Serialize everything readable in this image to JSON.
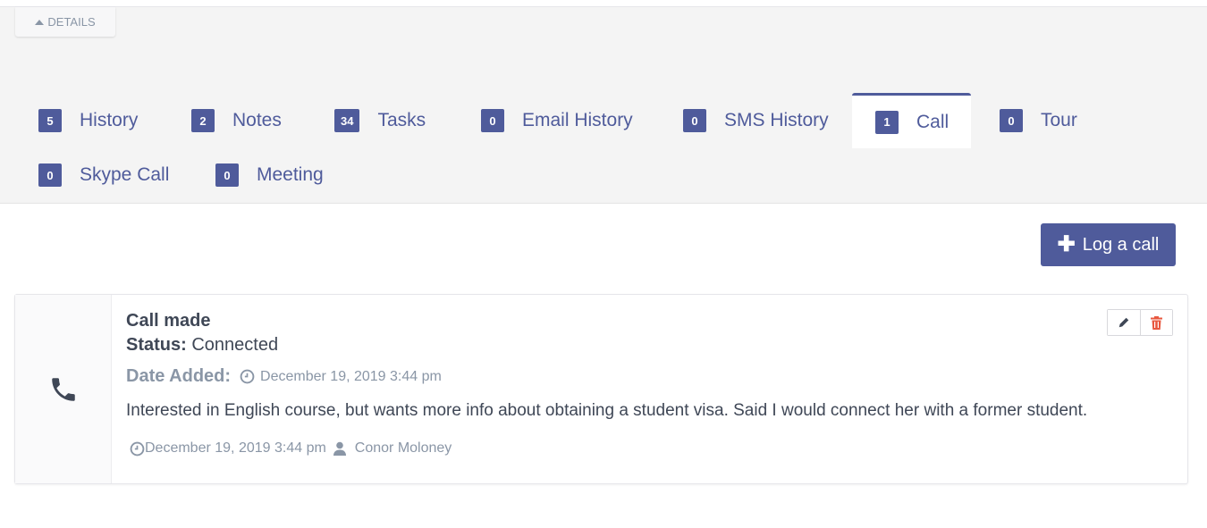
{
  "details_toggle": {
    "label": "DETAILS",
    "icon": "caret-up-icon"
  },
  "tabs": [
    {
      "count": "5",
      "label": "History",
      "active": false
    },
    {
      "count": "2",
      "label": "Notes",
      "active": false
    },
    {
      "count": "34",
      "label": "Tasks",
      "active": false
    },
    {
      "count": "0",
      "label": "Email History",
      "active": false
    },
    {
      "count": "0",
      "label": "SMS History",
      "active": false
    },
    {
      "count": "1",
      "label": "Call",
      "active": true
    },
    {
      "count": "0",
      "label": "Tour",
      "active": false
    },
    {
      "count": "0",
      "label": "Skype Call",
      "active": false
    },
    {
      "count": "0",
      "label": "Meeting",
      "active": false
    }
  ],
  "log_call_button": {
    "label": "Log a call",
    "icon": "plus-icon"
  },
  "call_entry": {
    "icon": "phone-icon",
    "title": "Call made",
    "status_label": "Status:",
    "status_value": "Connected",
    "date_added_label": "Date Added:",
    "date_added_value": "December 19, 2019 3:44 pm",
    "description": "Interested in English course, but wants more info about obtaining a student visa. Said I would connect her with a former student.",
    "meta_date": "December 19, 2019 3:44 pm",
    "meta_user": "Conor Moloney",
    "actions": {
      "edit": "pencil-icon",
      "delete": "trash-icon"
    }
  },
  "colors": {
    "accent": "#4f5b9b",
    "delete": "#e8583f",
    "muted": "#8a96a6"
  }
}
